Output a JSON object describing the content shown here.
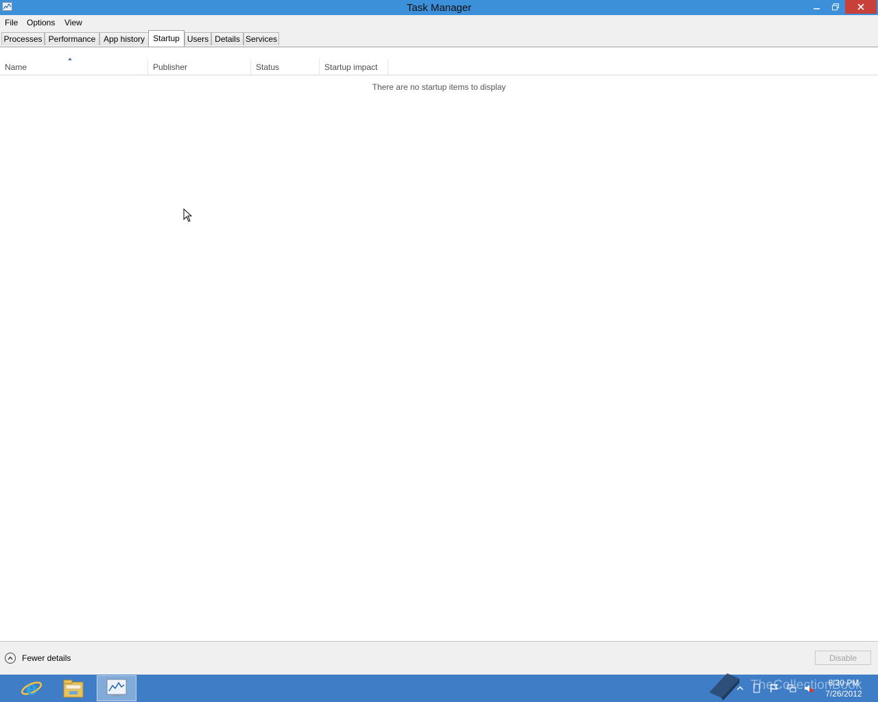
{
  "window": {
    "title": "Task Manager",
    "controls": {
      "minimize": "minimize",
      "maximize": "restore",
      "close": "close"
    }
  },
  "menu": {
    "items": [
      "File",
      "Options",
      "View"
    ]
  },
  "tabs": [
    {
      "label": "Processes",
      "active": false
    },
    {
      "label": "Performance",
      "active": false
    },
    {
      "label": "App history",
      "active": false
    },
    {
      "label": "Startup",
      "active": true
    },
    {
      "label": "Users",
      "active": false
    },
    {
      "label": "Details",
      "active": false
    },
    {
      "label": "Services",
      "active": false
    }
  ],
  "table": {
    "columns": [
      "Name",
      "Publisher",
      "Status",
      "Startup impact"
    ],
    "sorted_by": "Name",
    "sort_direction": "ascending",
    "empty_message": "There are no startup items to display"
  },
  "footer": {
    "fewer_details_label": "Fewer details",
    "disable_label": "Disable",
    "disable_enabled": false
  },
  "taskbar": {
    "pinned": [
      "internet-explorer-icon",
      "file-explorer-icon",
      "task-manager-icon"
    ],
    "clock_time": "8:30 PM",
    "clock_date": "7/26/2012",
    "watermark": "TheCollectionBook"
  },
  "colors": {
    "titlebar": "#3c8fd9",
    "close_button": "#c7403a",
    "taskbar": "#3f7ec6",
    "chrome": "#f0f0f0"
  }
}
